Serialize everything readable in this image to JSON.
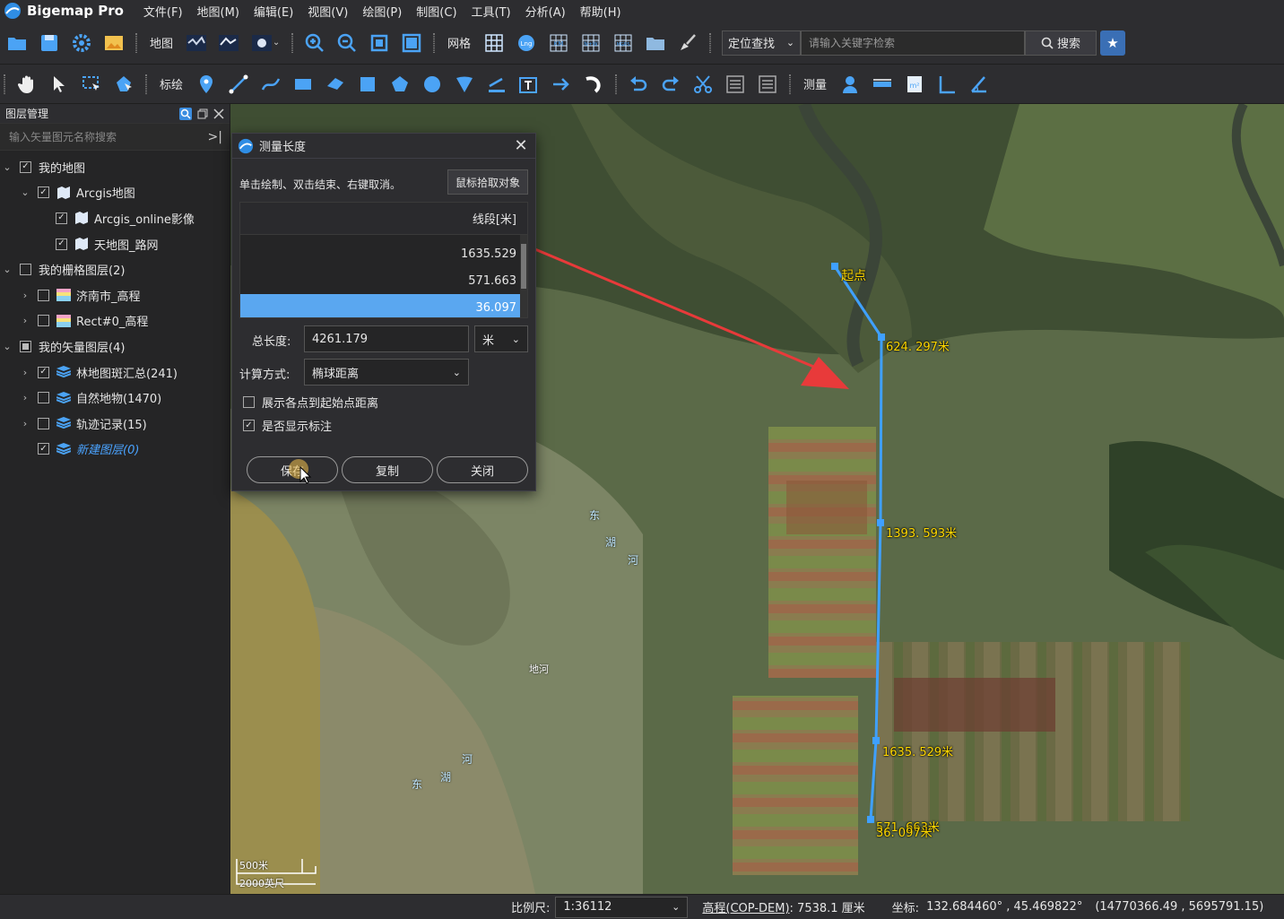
{
  "app": {
    "title": "Bigemap Pro",
    "menu": [
      "文件(F)",
      "地图(M)",
      "编辑(E)",
      "视图(V)",
      "绘图(P)",
      "制图(C)",
      "工具(T)",
      "分析(A)",
      "帮助(H)"
    ]
  },
  "toolbar1": {
    "map_label": "地图",
    "grid_label": "网格",
    "locate_select": "定位查找",
    "search_placeholder": "请输入关键字检索",
    "search_button": "搜索"
  },
  "toolbar2": {
    "annotate_label": "标绘",
    "measure_label": "测量"
  },
  "layer_panel": {
    "title": "图层管理",
    "search_placeholder": "输入矢量图元名称搜索",
    "items": [
      {
        "label": "我的地图",
        "checked": true
      },
      {
        "label": "Arcgis地图",
        "checked": true
      },
      {
        "label": "Arcgis_online影像",
        "checked": true
      },
      {
        "label": "天地图_路网",
        "checked": true
      },
      {
        "label": "我的栅格图层(2)",
        "checked": false
      },
      {
        "label": "济南市_高程",
        "checked": false
      },
      {
        "label": "Rect#0_高程",
        "checked": false
      },
      {
        "label": "我的矢量图层(4)",
        "checked": "partial"
      },
      {
        "label": "林地图斑汇总(241)",
        "checked": true
      },
      {
        "label": "自然地物(1470)",
        "checked": false
      },
      {
        "label": "轨迹记录(15)",
        "checked": false
      },
      {
        "label": "新建图层(0)",
        "checked": true
      }
    ]
  },
  "dialog": {
    "title": "测量长度",
    "instruction": "单击绘制、双击结束、右键取消。",
    "pick_button": "鼠标拾取对象",
    "column_header": "线段[米]",
    "segments": [
      "1635.529",
      "571.663",
      "36.097"
    ],
    "selected_segment_index": 2,
    "total_label": "总长度:",
    "total_value": "4261.179",
    "unit": "米",
    "method_label": "计算方式:",
    "method_value": "椭球距离",
    "option_distance_from_start": "展示各点到起始点距离",
    "option_distance_from_start_checked": false,
    "option_show_labels": "是否显示标注",
    "option_show_labels_checked": true,
    "save_button": "保存",
    "copy_button": "复制",
    "close_button": "关闭"
  },
  "map": {
    "start_label": "起点",
    "measure_labels": [
      "624. 297米",
      "1393. 593米",
      "1635. 529米",
      "571. 663米",
      "36. 097米"
    ],
    "river_label_1": [
      "东",
      "湖",
      "河"
    ],
    "river_label_2": [
      "东",
      "湖",
      "河"
    ],
    "place_label": "地河",
    "scale_top": "500米",
    "scale_bottom": "2000英尺"
  },
  "statusbar": {
    "scale_label": "比例尺:",
    "scale_value": "1:36112",
    "elevation_label": "高程(COP-DEM)",
    "elevation_value": ": 7538.1 厘米",
    "coord_label": "坐标:",
    "coord_value": "132.684460° , 45.469822°",
    "projected_value": "(14770366.49 , 5695791.15)"
  },
  "colors": {
    "accent": "#3a6fb5",
    "selected_row": "#5aa7f0",
    "measure_line": "#3fa0ff",
    "arrow": "#e83a3a",
    "label_yellow": "#ffd800"
  }
}
